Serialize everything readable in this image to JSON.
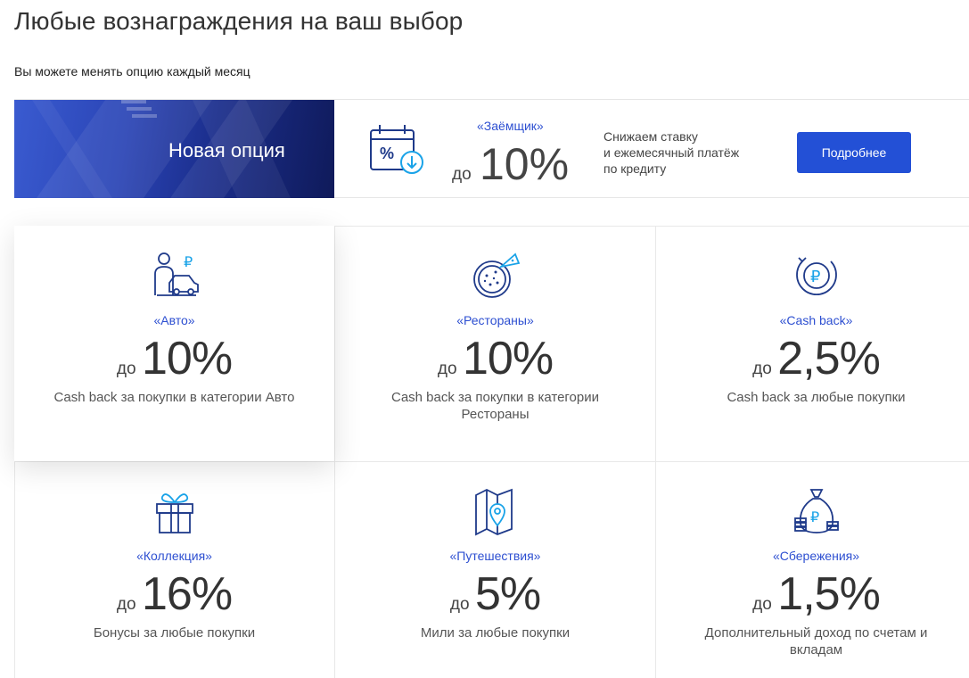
{
  "page": {
    "title": "Любые вознаграждения на ваш выбор",
    "subtitle": "Вы можете менять опцию каждый месяц"
  },
  "promo": {
    "banner_label": "Новая опция",
    "name": "«Заёмщик»",
    "prefix": "до",
    "value": "10%",
    "desc_lines": [
      "Снижаем ставку",
      "и ежемесячный платёж",
      "по кредиту"
    ],
    "button_label": "Подробнее",
    "icon": "calendar-percent-icon"
  },
  "colors": {
    "accent": "#2350d6",
    "link": "#2d4fd1",
    "banner_dark": "#0f1a5a",
    "icon_stroke": "#1f3a8a",
    "icon_accent": "#1aa3e8"
  },
  "options": [
    {
      "name": "«Авто»",
      "prefix": "до",
      "value": "10%",
      "desc": "Cash back за покупки в категории Авто",
      "icon": "car-driver-icon",
      "active": true
    },
    {
      "name": "«Рестораны»",
      "prefix": "до",
      "value": "10%",
      "desc": "Cash back за покупки в категории Рестораны",
      "icon": "pizza-icon",
      "active": false
    },
    {
      "name": "«Cash back»",
      "prefix": "до",
      "value": "2,5%",
      "desc": "Cash back за любые покупки",
      "icon": "ruble-coin-icon",
      "active": false
    },
    {
      "name": "«Коллекция»",
      "prefix": "до",
      "value": "16%",
      "desc": "Бонусы за любые покупки",
      "icon": "gift-icon",
      "active": false
    },
    {
      "name": "«Путешествия»",
      "prefix": "до",
      "value": "5%",
      "desc": "Мили за любые покупки",
      "icon": "map-pin-icon",
      "active": false
    },
    {
      "name": "«Сбережения»",
      "prefix": "до",
      "value": "1,5%",
      "desc": "Дополнительный доход по счетам и вкладам",
      "icon": "money-bag-icon",
      "active": false
    }
  ]
}
